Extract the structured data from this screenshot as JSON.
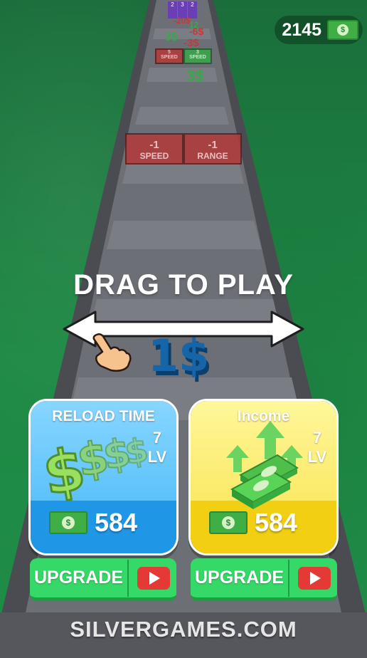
{
  "hud": {
    "money": "2145",
    "money_icon": "dollar-bill-icon"
  },
  "gates_far": [
    {
      "value": "5",
      "label": "SPEED"
    },
    {
      "value": "3",
      "label": "SPEED"
    }
  ],
  "gates_near": [
    {
      "value": "-1",
      "label": "SPEED"
    },
    {
      "value": "-1",
      "label": "RANGE"
    }
  ],
  "floating_values": [
    "-20$",
    "-6$",
    "-3$",
    "3$",
    "3$",
    "12"
  ],
  "top_boxes": [
    "2",
    "3",
    "2"
  ],
  "instruction": "DRAG TO PLAY",
  "player_value": "1$",
  "cards": [
    {
      "title": "RELOAD TIME",
      "level": "7",
      "level_unit": "LV",
      "price": "584"
    },
    {
      "title": "Income",
      "level": "7",
      "level_unit": "LV",
      "price": "584"
    }
  ],
  "upgrade_label": "UPGRADE",
  "footer": "SILVERGAMES.COM",
  "colors": {
    "water": "#1e8a45",
    "road": "#6b6d74",
    "reload_card": "#1f97e6",
    "income_card": "#f2cf12",
    "upgrade_button": "#35d967"
  }
}
